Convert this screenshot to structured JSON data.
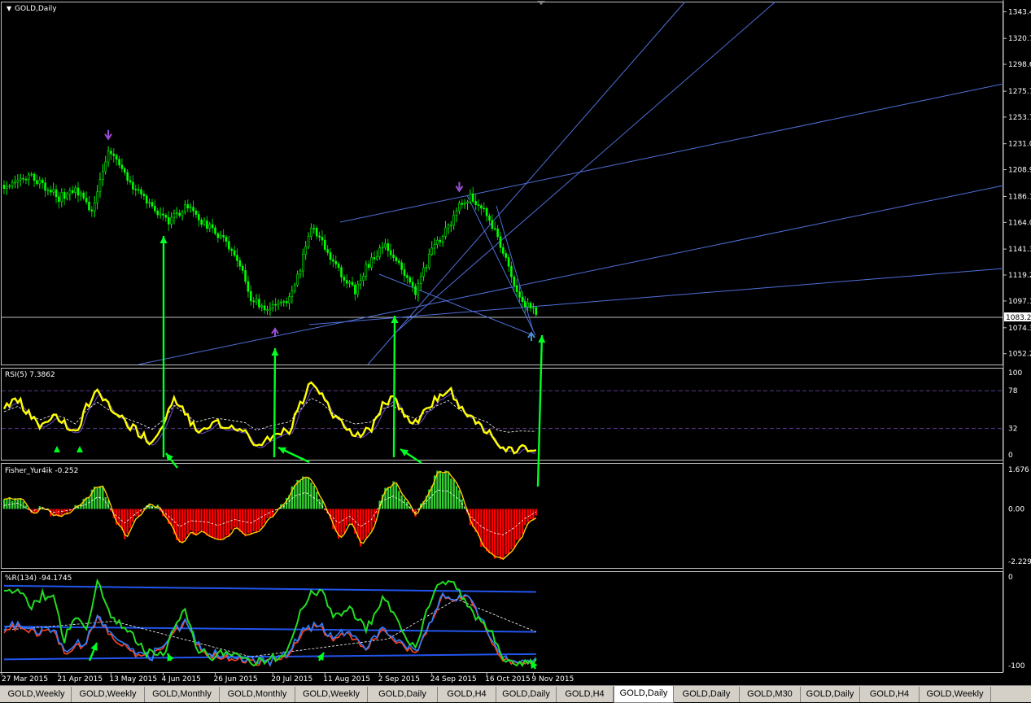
{
  "window": {
    "title": "GOLD,Daily"
  },
  "colors": {
    "background": "#000000",
    "bull": "#00ff00",
    "bear": "#00c800",
    "trendline": "#4f6fd8",
    "rsi": "#ffff00",
    "arrow": "#00ff22",
    "fisher_pos": "#33cc33",
    "fisher_neg": "#ff0000",
    "signal_arrow_top": "#9b4fd6",
    "wpr_green": "#22dd22",
    "wpr_red": "#ff4422",
    "wpr_blue": "#2f7fff"
  },
  "price_axis": {
    "ticks": [
      "1343.4",
      "1320.7",
      "1298.6",
      "1275.7",
      "1253.7",
      "1231.0",
      "1208.9",
      "1186.1",
      "1164.0",
      "1141.3",
      "1119.2",
      "1097.1",
      "1074.3",
      "1052.2"
    ],
    "current": "1083.2"
  },
  "panels": {
    "rsi": {
      "label": "RSI(5) 7.3862",
      "levels": [
        "100",
        "78",
        "32",
        "0"
      ]
    },
    "fisher": {
      "label": "Fisher_Yur4ik -0.252",
      "levels": [
        "1.676",
        "0.00",
        "-2.229"
      ]
    },
    "wpr": {
      "label": "%R(134) -94.1745",
      "levels": [
        "0",
        "-100"
      ]
    }
  },
  "time_axis": [
    "27 Mar 2015",
    "21 Apr 2015",
    "13 May 2015",
    "4 Jun 2015",
    "26 Jun 2015",
    "20 Jul 2015",
    "11 Aug 2015",
    "2 Sep 2015",
    "24 Sep 2015",
    "16 Oct 2015",
    "9 Nov 2015"
  ],
  "tabs": [
    "GOLD,Weekly",
    "GOLD,Weekly",
    "GOLD,Monthly",
    "GOLD,Monthly",
    "GOLD,Weekly",
    "GOLD,Daily",
    "GOLD,H4",
    "GOLD,Daily",
    "GOLD,H4",
    "GOLD,Daily",
    "GOLD,Daily",
    "GOLD,M30",
    "GOLD,Daily",
    "GOLD,H4",
    "GOLD,Weekly"
  ],
  "active_tab": 9,
  "chart_data": {
    "type": "candlestick",
    "title": "GOLD,Daily",
    "ylim": [
      1043,
      1352
    ],
    "close_anchors": [
      [
        0,
        1190
      ],
      [
        6,
        1205
      ],
      [
        12,
        1200
      ],
      [
        20,
        1185
      ],
      [
        26,
        1192
      ],
      [
        32,
        1175
      ],
      [
        38,
        1225
      ],
      [
        44,
        1205
      ],
      [
        52,
        1180
      ],
      [
        60,
        1163
      ],
      [
        66,
        1178
      ],
      [
        72,
        1165
      ],
      [
        80,
        1150
      ],
      [
        86,
        1130
      ],
      [
        90,
        1100
      ],
      [
        96,
        1090
      ],
      [
        104,
        1100
      ],
      [
        108,
        1125
      ],
      [
        112,
        1160
      ],
      [
        118,
        1140
      ],
      [
        124,
        1115
      ],
      [
        128,
        1105
      ],
      [
        132,
        1125
      ],
      [
        138,
        1145
      ],
      [
        144,
        1130
      ],
      [
        150,
        1105
      ],
      [
        156,
        1140
      ],
      [
        162,
        1160
      ],
      [
        166,
        1180
      ],
      [
        170,
        1185
      ],
      [
        176,
        1170
      ],
      [
        180,
        1150
      ],
      [
        184,
        1125
      ],
      [
        188,
        1098
      ],
      [
        194,
        1087
      ]
    ],
    "signals": {
      "sell_arrows_idx": [
        38,
        166
      ],
      "buy_arrows_idx": [
        92,
        187
      ]
    },
    "rsi_anchors": [
      [
        0,
        55
      ],
      [
        5,
        68
      ],
      [
        9,
        50
      ],
      [
        13,
        35
      ],
      [
        18,
        48
      ],
      [
        22,
        40
      ],
      [
        26,
        25
      ],
      [
        30,
        58
      ],
      [
        34,
        78
      ],
      [
        38,
        60
      ],
      [
        44,
        40
      ],
      [
        50,
        25
      ],
      [
        54,
        12
      ],
      [
        58,
        35
      ],
      [
        62,
        70
      ],
      [
        66,
        50
      ],
      [
        70,
        30
      ],
      [
        76,
        40
      ],
      [
        82,
        35
      ],
      [
        88,
        28
      ],
      [
        92,
        10
      ],
      [
        98,
        22
      ],
      [
        104,
        30
      ],
      [
        108,
        60
      ],
      [
        112,
        88
      ],
      [
        116,
        75
      ],
      [
        120,
        50
      ],
      [
        124,
        35
      ],
      [
        128,
        25
      ],
      [
        134,
        30
      ],
      [
        138,
        62
      ],
      [
        142,
        70
      ],
      [
        146,
        48
      ],
      [
        150,
        38
      ],
      [
        154,
        55
      ],
      [
        158,
        70
      ],
      [
        162,
        82
      ],
      [
        166,
        60
      ],
      [
        170,
        45
      ],
      [
        176,
        30
      ],
      [
        180,
        10
      ],
      [
        184,
        5
      ],
      [
        188,
        8
      ],
      [
        194,
        7
      ]
    ],
    "fisher_anchors": [
      [
        0,
        0.3
      ],
      [
        5,
        0.5
      ],
      [
        10,
        -0.2
      ],
      [
        14,
        0.1
      ],
      [
        18,
        -0.3
      ],
      [
        24,
        -0.1
      ],
      [
        30,
        0.4
      ],
      [
        34,
        1.0
      ],
      [
        36,
        0.9
      ],
      [
        40,
        -0.4
      ],
      [
        44,
        -1.2
      ],
      [
        48,
        -0.4
      ],
      [
        52,
        0.2
      ],
      [
        56,
        0.1
      ],
      [
        60,
        -0.6
      ],
      [
        64,
        -1.5
      ],
      [
        68,
        -1.0
      ],
      [
        74,
        -1.1
      ],
      [
        78,
        -1.4
      ],
      [
        84,
        -0.9
      ],
      [
        90,
        -1.2
      ],
      [
        96,
        -0.4
      ],
      [
        102,
        0.2
      ],
      [
        106,
        1.1
      ],
      [
        110,
        1.4
      ],
      [
        114,
        0.8
      ],
      [
        118,
        -0.3
      ],
      [
        122,
        -1.2
      ],
      [
        126,
        -0.6
      ],
      [
        130,
        -1.5
      ],
      [
        134,
        -0.9
      ],
      [
        138,
        0.7
      ],
      [
        142,
        1.1
      ],
      [
        146,
        0.5
      ],
      [
        150,
        -0.3
      ],
      [
        154,
        0.6
      ],
      [
        158,
        1.6
      ],
      [
        162,
        1.5
      ],
      [
        166,
        0.8
      ],
      [
        170,
        -0.6
      ],
      [
        174,
        -1.5
      ],
      [
        178,
        -2.0
      ],
      [
        182,
        -2.2
      ],
      [
        186,
        -1.6
      ],
      [
        190,
        -0.8
      ],
      [
        194,
        -0.25
      ]
    ],
    "wpr_green_anchors": [
      [
        0,
        -20
      ],
      [
        6,
        -15
      ],
      [
        10,
        -35
      ],
      [
        14,
        -20
      ],
      [
        18,
        -25
      ],
      [
        22,
        -70
      ],
      [
        26,
        -45
      ],
      [
        30,
        -60
      ],
      [
        34,
        -5
      ],
      [
        38,
        -40
      ],
      [
        44,
        -60
      ],
      [
        48,
        -70
      ],
      [
        52,
        -85
      ],
      [
        58,
        -90
      ],
      [
        62,
        -60
      ],
      [
        66,
        -35
      ],
      [
        70,
        -80
      ],
      [
        76,
        -90
      ],
      [
        82,
        -85
      ],
      [
        88,
        -95
      ],
      [
        94,
        -95
      ],
      [
        100,
        -90
      ],
      [
        104,
        -80
      ],
      [
        108,
        -40
      ],
      [
        112,
        -20
      ],
      [
        116,
        -15
      ],
      [
        120,
        -45
      ],
      [
        126,
        -35
      ],
      [
        132,
        -60
      ],
      [
        138,
        -25
      ],
      [
        142,
        -40
      ],
      [
        146,
        -70
      ],
      [
        150,
        -80
      ],
      [
        154,
        -40
      ],
      [
        158,
        -10
      ],
      [
        162,
        -5
      ],
      [
        166,
        -15
      ],
      [
        172,
        -45
      ],
      [
        178,
        -60
      ],
      [
        182,
        -95
      ],
      [
        188,
        -100
      ],
      [
        194,
        -94
      ]
    ],
    "wpr_other_anchors": [
      [
        0,
        -60
      ],
      [
        6,
        -55
      ],
      [
        12,
        -65
      ],
      [
        18,
        -60
      ],
      [
        22,
        -85
      ],
      [
        30,
        -75
      ],
      [
        34,
        -45
      ],
      [
        40,
        -70
      ],
      [
        48,
        -88
      ],
      [
        54,
        -90
      ],
      [
        60,
        -70
      ],
      [
        66,
        -50
      ],
      [
        72,
        -85
      ],
      [
        80,
        -90
      ],
      [
        88,
        -95
      ],
      [
        96,
        -97
      ],
      [
        104,
        -90
      ],
      [
        108,
        -65
      ],
      [
        114,
        -55
      ],
      [
        120,
        -70
      ],
      [
        126,
        -65
      ],
      [
        132,
        -80
      ],
      [
        138,
        -60
      ],
      [
        144,
        -75
      ],
      [
        150,
        -85
      ],
      [
        156,
        -50
      ],
      [
        160,
        -20
      ],
      [
        164,
        -25
      ],
      [
        170,
        -25
      ],
      [
        176,
        -60
      ],
      [
        182,
        -95
      ],
      [
        188,
        -97
      ],
      [
        194,
        -96
      ]
    ]
  }
}
